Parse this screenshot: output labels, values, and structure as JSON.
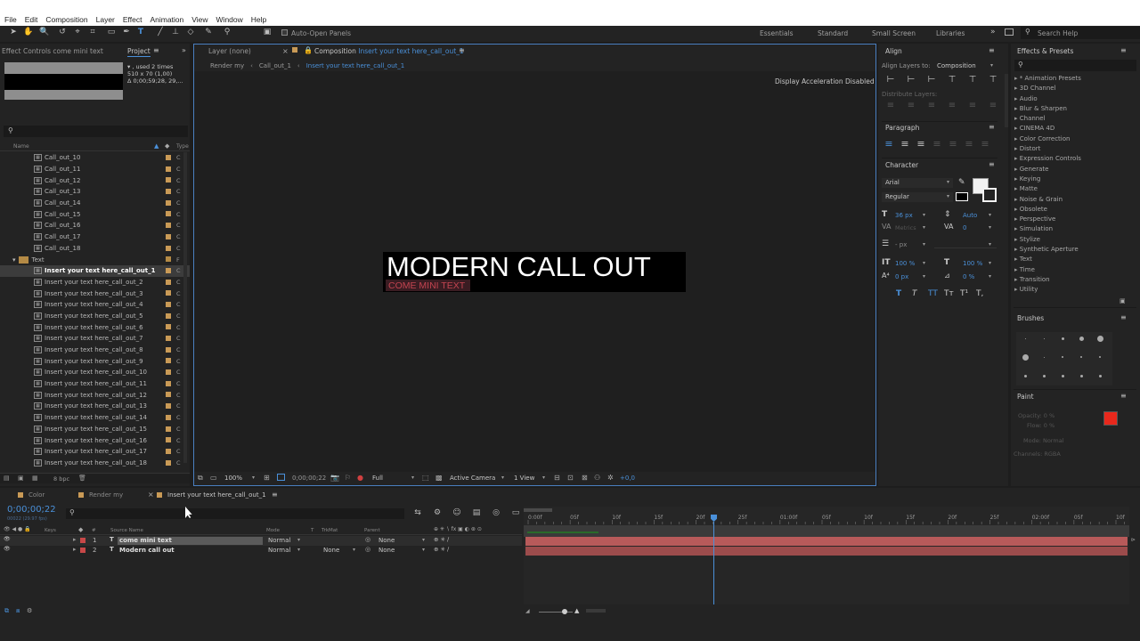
{
  "menu": [
    "File",
    "Edit",
    "Composition",
    "Layer",
    "Effect",
    "Animation",
    "View",
    "Window",
    "Help"
  ],
  "toolbar": {
    "auto_open_label": "Auto-Open Panels"
  },
  "workspaces": [
    "Essentials",
    "Standard",
    "Small Screen",
    "Libraries"
  ],
  "search_help_placeholder": "Search Help",
  "effect_controls": {
    "title": "Effect Controls come mini text"
  },
  "project": {
    "tab": "Project",
    "used_info": "▾ , used 2 times",
    "dims": "510 x 70 (1,00)",
    "duration": "Δ 0;00;59;28, 29,...",
    "col_name": "Name",
    "col_type": "Type",
    "items": [
      {
        "name": "Call_out_10",
        "type": "C"
      },
      {
        "name": "Call_out_11",
        "type": "C"
      },
      {
        "name": "Call_out_12",
        "type": "C"
      },
      {
        "name": "Call_out_13",
        "type": "C"
      },
      {
        "name": "Call_out_14",
        "type": "C"
      },
      {
        "name": "Call_out_15",
        "type": "C"
      },
      {
        "name": "Call_out_16",
        "type": "C"
      },
      {
        "name": "Call_out_17",
        "type": "C"
      },
      {
        "name": "Call_out_18",
        "type": "C"
      },
      {
        "name": "Text",
        "type": "F",
        "folder": true
      },
      {
        "name": "Insert your text here_call_out_1",
        "type": "C",
        "selected": true
      },
      {
        "name": "Insert your text here_call_out_2",
        "type": "C"
      },
      {
        "name": "Insert your text here_call_out_3",
        "type": "C"
      },
      {
        "name": "Insert your text here_call_out_4",
        "type": "C"
      },
      {
        "name": "Insert your text here_call_out_5",
        "type": "C"
      },
      {
        "name": "Insert your text here_call_out_6",
        "type": "C"
      },
      {
        "name": "Insert your text here_call_out_7",
        "type": "C"
      },
      {
        "name": "Insert your text here_call_out_8",
        "type": "C"
      },
      {
        "name": "Insert your text here_call_out_9",
        "type": "C"
      },
      {
        "name": "Insert your text here_call_out_10",
        "type": "C"
      },
      {
        "name": "Insert your text here_call_out_11",
        "type": "C"
      },
      {
        "name": "Insert your text here_call_out_12",
        "type": "C"
      },
      {
        "name": "Insert your text here_call_out_13",
        "type": "C"
      },
      {
        "name": "Insert your text here_call_out_14",
        "type": "C"
      },
      {
        "name": "Insert your text here_call_out_15",
        "type": "C"
      },
      {
        "name": "Insert your text here_call_out_16",
        "type": "C"
      },
      {
        "name": "Insert your text here_call_out_17",
        "type": "C"
      },
      {
        "name": "Insert your text here_call_out_18",
        "type": "C"
      }
    ],
    "bpc": "8 bpc"
  },
  "comp": {
    "layer_tab": "Layer (none)",
    "comp_tab_prefix": "Composition",
    "comp_tab_name": "Insert your text here_call_out_1",
    "breadcrumbs": [
      "Render my",
      "Call_out_1",
      "Insert your text here_call_out_1"
    ],
    "accel_notice": "Display Acceleration Disabled",
    "main_text": "MODERN CALL OUT",
    "sub_text": "COME MINI TEXT",
    "zoom": "100%",
    "timecode": "0;00;00;22",
    "quality": "Full",
    "camera": "Active Camera",
    "view": "1 View",
    "exposure": "+0,0"
  },
  "align": {
    "title": "Align",
    "align_to_label": "Align Layers to:",
    "align_to_value": "Composition",
    "distribute_label": "Distribute Layers:"
  },
  "paragraph": {
    "title": "Paragraph"
  },
  "character": {
    "title": "Character",
    "font": "Arial",
    "style": "Regular",
    "size": "36 px",
    "leading": "Auto",
    "kerning": "Metrics",
    "tracking": "0",
    "stroke": "- px",
    "vscale": "100 %",
    "hscale": "100 %",
    "baseline": "0 px",
    "tsume": "0 %"
  },
  "effects": {
    "title": "Effects & Presets",
    "items": [
      "* Animation Presets",
      "3D Channel",
      "Audio",
      "Blur & Sharpen",
      "Channel",
      "CINEMA 4D",
      "Color Correction",
      "Distort",
      "Expression Controls",
      "Generate",
      "Keying",
      "Matte",
      "Noise & Grain",
      "Obsolete",
      "Perspective",
      "Simulation",
      "Stylize",
      "Synthetic Aperture",
      "Text",
      "Time",
      "Transition",
      "Utility"
    ]
  },
  "brushes": {
    "title": "Brushes"
  },
  "paint": {
    "title": "Paint",
    "opacity": "Opacity: 0 %",
    "flow": "Flow: 0 %",
    "mode": "Mode: Normal",
    "channels": "Channels: RGBA",
    "fg_color": "#e8281c"
  },
  "timeline": {
    "tabs": [
      "Color",
      "Render my",
      "Insert your text here_call_out_1"
    ],
    "timecode": "0;00;00;22",
    "frame_info": "00022 (29.97 fps)",
    "col_source": "Source Name",
    "col_mode": "Mode",
    "col_t": "T",
    "col_trkmat": "TrkMat",
    "col_parent": "Parent",
    "col_keys": "Keys",
    "ruler": [
      "0:00f",
      "05f",
      "10f",
      "15f",
      "20f",
      "25f",
      "01:00f",
      "05f",
      "10f",
      "15f",
      "20f",
      "25f",
      "02:00f",
      "05f",
      "10f"
    ],
    "layers": [
      {
        "num": "1",
        "name": "come mini text",
        "mode": "Normal",
        "trkmat": "",
        "parent": "None",
        "selected": true
      },
      {
        "num": "2",
        "name": "Modern call out",
        "mode": "Normal",
        "trkmat": "None",
        "parent": "None",
        "selected": false
      }
    ]
  }
}
